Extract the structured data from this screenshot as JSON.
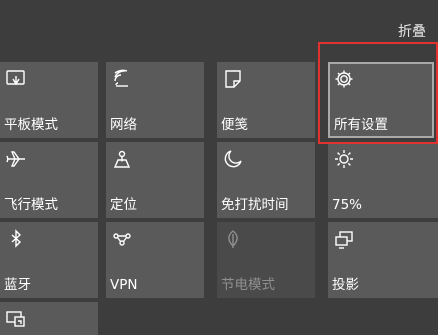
{
  "header": {
    "collapse_label": "折叠"
  },
  "tiles": [
    {
      "label": "平板模式",
      "icon": "tablet-mode-icon"
    },
    {
      "label": "网络",
      "icon": "network-icon"
    },
    {
      "label": "便笺",
      "icon": "note-icon"
    },
    {
      "label": "所有设置",
      "icon": "gear-icon"
    },
    {
      "label": "飞行模式",
      "icon": "airplane-icon"
    },
    {
      "label": "定位",
      "icon": "location-icon"
    },
    {
      "label": "免打扰时间",
      "icon": "moon-icon"
    },
    {
      "label": "75%",
      "icon": "brightness-icon"
    },
    {
      "label": "蓝牙",
      "icon": "bluetooth-icon"
    },
    {
      "label": "VPN",
      "icon": "vpn-icon"
    },
    {
      "label": "节电模式",
      "icon": "battery-saver-icon"
    },
    {
      "label": "投影",
      "icon": "project-icon"
    },
    {
      "label": "",
      "icon": "connect-icon"
    }
  ],
  "colors": {
    "background": "#3d3d3d",
    "tile": "#5a5a5a",
    "tile_disabled": "#4a4a4a",
    "highlight": "#e0332f"
  }
}
